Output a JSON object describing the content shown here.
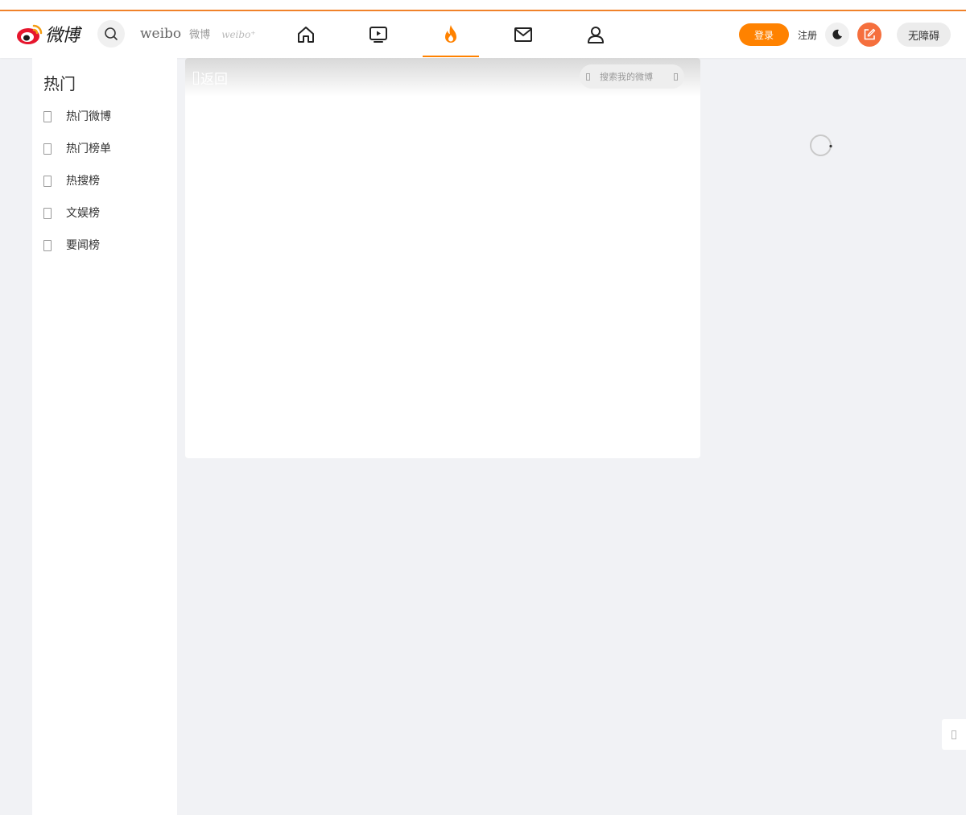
{
  "header": {
    "logo_text": "微博",
    "brand": {
      "weibo": "weibo",
      "cn": "微博",
      "italic": "weibo⁺"
    },
    "nav": [
      {
        "name": "home-icon"
      },
      {
        "name": "video-icon"
      },
      {
        "name": "hot-icon",
        "active": true
      },
      {
        "name": "mail-icon"
      },
      {
        "name": "user-icon"
      }
    ],
    "login_label": "登录",
    "register_label": "注册",
    "accessibility_label": "无障碍"
  },
  "sidebar": {
    "title": "热门",
    "items": [
      {
        "label": "热门微博"
      },
      {
        "label": "热门榜单"
      },
      {
        "label": "热搜榜"
      },
      {
        "label": "文娱榜"
      },
      {
        "label": "要闻榜"
      }
    ]
  },
  "main": {
    "back_label": "返回",
    "search_placeholder": "搜索我的微博"
  },
  "colors": {
    "accent": "#ff8200",
    "compose": "#f56f3d",
    "background": "#f1f2f5"
  }
}
